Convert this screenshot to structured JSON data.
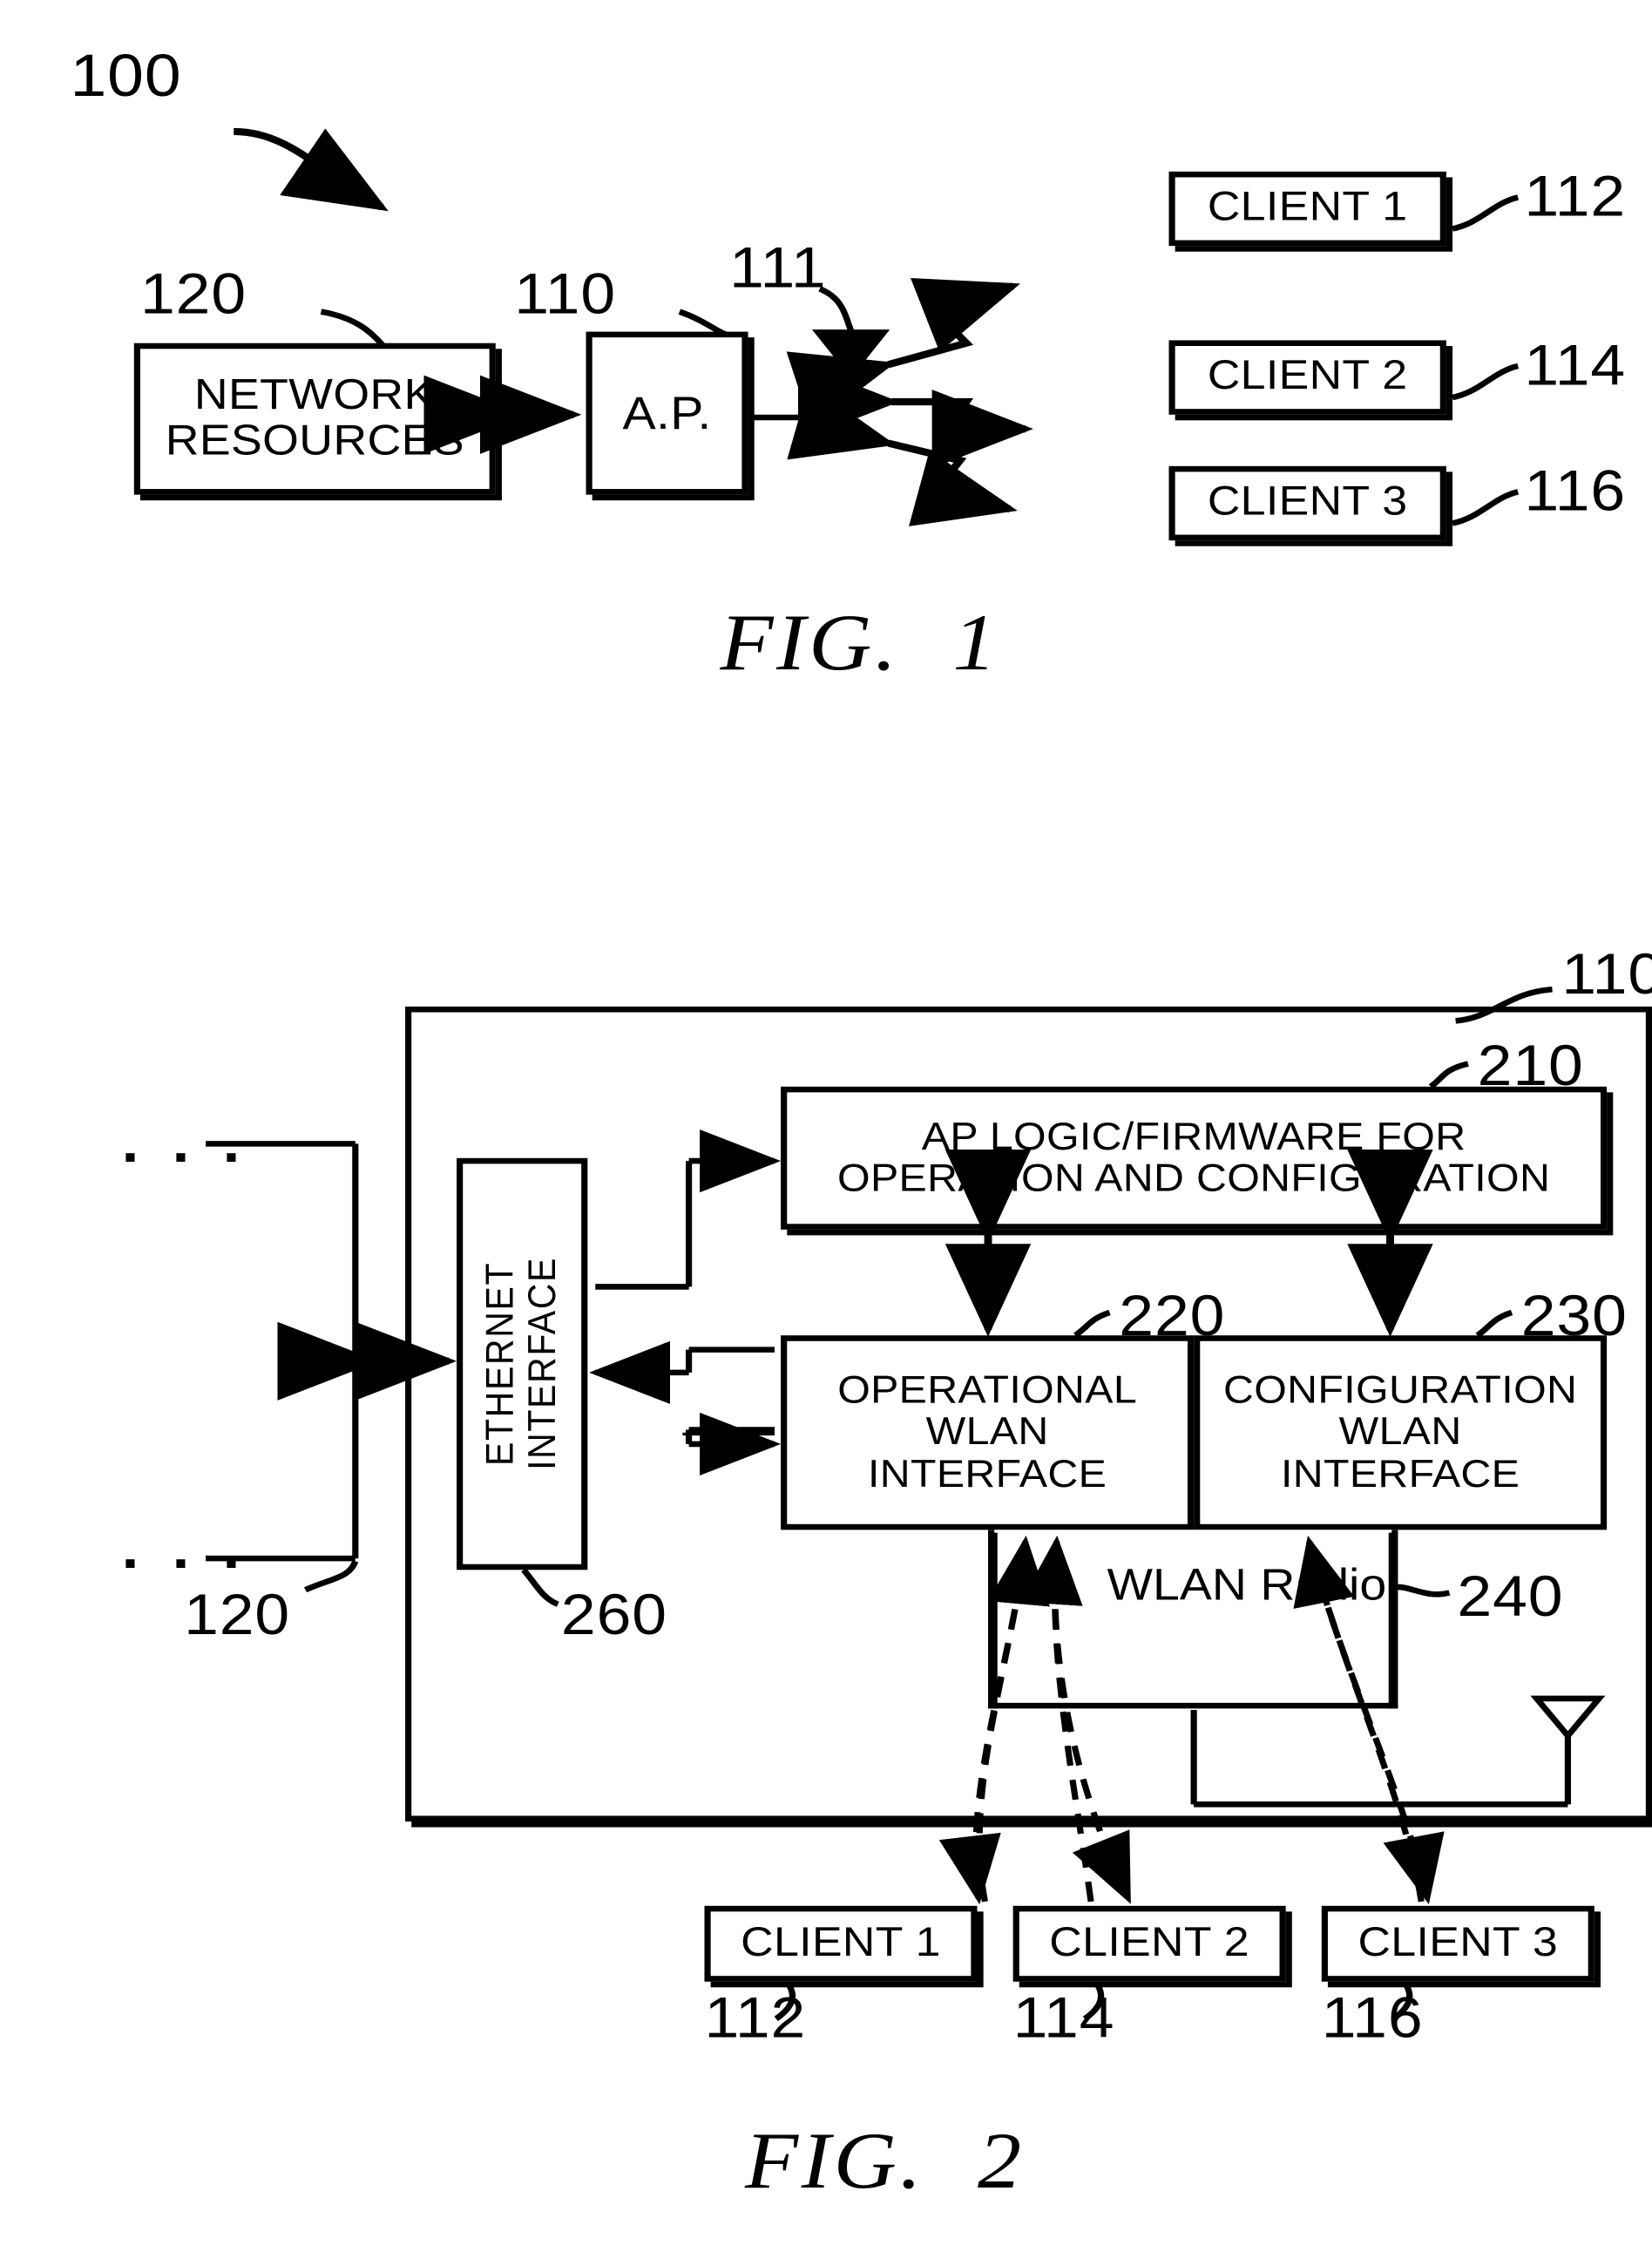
{
  "figure1": {
    "system_ref": "100",
    "caption": "FIG.",
    "caption_num": "1",
    "network_resources": {
      "line1": "NETWORK",
      "line2": "RESOURCES",
      "ref": "120"
    },
    "access_point": {
      "label": "A.P.",
      "ref": "110"
    },
    "antenna": {
      "ref": "111",
      "icon": "antenna-icon"
    },
    "clients": [
      {
        "label": "CLIENT 1",
        "ref": "112"
      },
      {
        "label": "CLIENT 2",
        "ref": "114"
      },
      {
        "label": "CLIENT 3",
        "ref": "116"
      }
    ]
  },
  "figure2": {
    "caption": "FIG.",
    "caption_num": "2",
    "ap_enclosure_ref": "110",
    "network_ref": "120",
    "ap_logic": {
      "line1": "AP LOGIC/FIRMWARE FOR",
      "line2": "OPERATION AND CONFIGURATION",
      "ref": "210"
    },
    "ethernet_interface": {
      "line1": "ETHERNET",
      "line2": "INTERFACE",
      "ref": "260"
    },
    "operational_wlan": {
      "line1": "OPERATIONAL",
      "line2": "WLAN",
      "line3": "INTERFACE",
      "ref": "220"
    },
    "configuration_wlan": {
      "line1": "CONFIGURATION",
      "line2": "WLAN",
      "line3": "INTERFACE",
      "ref": "230"
    },
    "wlan_radio": {
      "line1": "WLAN",
      "line2": "Radio",
      "ref": "240"
    },
    "antenna": {
      "icon": "antenna-icon"
    },
    "clients": [
      {
        "label": "CLIENT 1",
        "ref": "112"
      },
      {
        "label": "CLIENT 2",
        "ref": "114"
      },
      {
        "label": "CLIENT 3",
        "ref": "116"
      }
    ],
    "ellipsis_top": "· · ·",
    "ellipsis_bottom": "· · ·"
  },
  "colors": {
    "ink": "#000000",
    "paper": "#ffffff"
  }
}
